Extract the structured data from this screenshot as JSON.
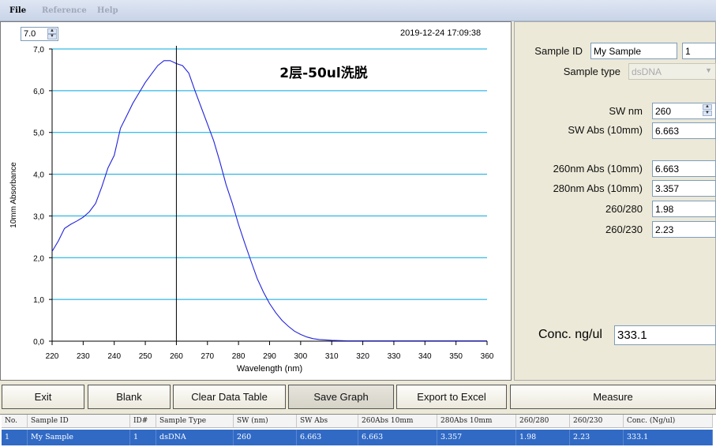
{
  "menu": {
    "file": "File",
    "reference": "Reference",
    "help": "Help"
  },
  "graph": {
    "zoom_value": "7.0",
    "timestamp": "2019-12-24 17:09:38",
    "annotation": "2层-50ul洗脱"
  },
  "chart_data": {
    "type": "line",
    "xlabel": "Wavelength (nm)",
    "ylabel": "10mm Absorbance",
    "xlim": [
      220,
      360
    ],
    "ylim": [
      0,
      7
    ],
    "xticks": [
      "220",
      "230",
      "240",
      "250",
      "260",
      "270",
      "280",
      "290",
      "300",
      "310",
      "320",
      "330",
      "340",
      "350",
      "360"
    ],
    "yticks": [
      "0,0",
      "1,0",
      "2,0",
      "3,0",
      "4,0",
      "5,0",
      "6,0",
      "7,0"
    ],
    "grid": "horizontal",
    "marker_x": 260,
    "series": [
      {
        "x": [
          220,
          222,
          224,
          226,
          228,
          230,
          232,
          234,
          236,
          238,
          240,
          242,
          244,
          246,
          248,
          250,
          252,
          254,
          256,
          258,
          260,
          262,
          264,
          266,
          268,
          270,
          272,
          274,
          276,
          278,
          280,
          282,
          284,
          286,
          288,
          290,
          292,
          294,
          296,
          298,
          300,
          302,
          304,
          306,
          308,
          310,
          312,
          315,
          320,
          330,
          340,
          350,
          360
        ],
        "y": [
          2.15,
          2.4,
          2.7,
          2.8,
          2.88,
          2.97,
          3.1,
          3.3,
          3.7,
          4.15,
          4.45,
          5.1,
          5.4,
          5.7,
          5.95,
          6.2,
          6.4,
          6.6,
          6.72,
          6.72,
          6.65,
          6.6,
          6.42,
          6.0,
          5.6,
          5.2,
          4.8,
          4.3,
          3.75,
          3.3,
          2.8,
          2.35,
          1.92,
          1.5,
          1.18,
          0.9,
          0.68,
          0.5,
          0.36,
          0.24,
          0.16,
          0.1,
          0.06,
          0.04,
          0.03,
          0.02,
          0.015,
          0.01,
          0.01,
          0.01,
          0.01,
          0.01,
          0.01
        ],
        "color": "#2222dd"
      }
    ]
  },
  "right_panel": {
    "sample_id_label": "Sample ID",
    "sample_id_value": "My Sample",
    "sample_num_value": "1",
    "sample_type_label": "Sample type",
    "sample_type_value": "dsDNA",
    "sw_nm_label": "SW nm",
    "sw_nm_value": "260",
    "sw_abs_label": "SW Abs (10mm)",
    "sw_abs_value": "6.663",
    "abs260_label": "260nm Abs (10mm)",
    "abs260_value": "6.663",
    "abs280_label": "280nm Abs (10mm)",
    "abs280_value": "3.357",
    "ratio_260_280_label": "260/280",
    "ratio_260_280_value": "1.98",
    "ratio_260_230_label": "260/230",
    "ratio_260_230_value": "2.23",
    "conc_label": "Conc. ng/ul",
    "conc_value": "333.1"
  },
  "buttons": {
    "exit": "Exit",
    "blank": "Blank",
    "clear": "Clear Data Table",
    "save": "Save Graph",
    "export": "Export to Excel",
    "measure": "Measure"
  },
  "table": {
    "headers": [
      "No.",
      "Sample ID",
      "ID#",
      "Sample Type",
      "SW (nm)",
      "SW Abs",
      "260Abs 10mm",
      "280Abs 10mm",
      "260/280",
      "260/230",
      "Conc. (Ng/ul)"
    ],
    "rows": [
      [
        "1",
        "My Sample",
        "1",
        "dsDNA",
        "260",
        "6.663",
        "6.663",
        "3.357",
        "1.98",
        "2.23",
        "333.1"
      ]
    ]
  }
}
